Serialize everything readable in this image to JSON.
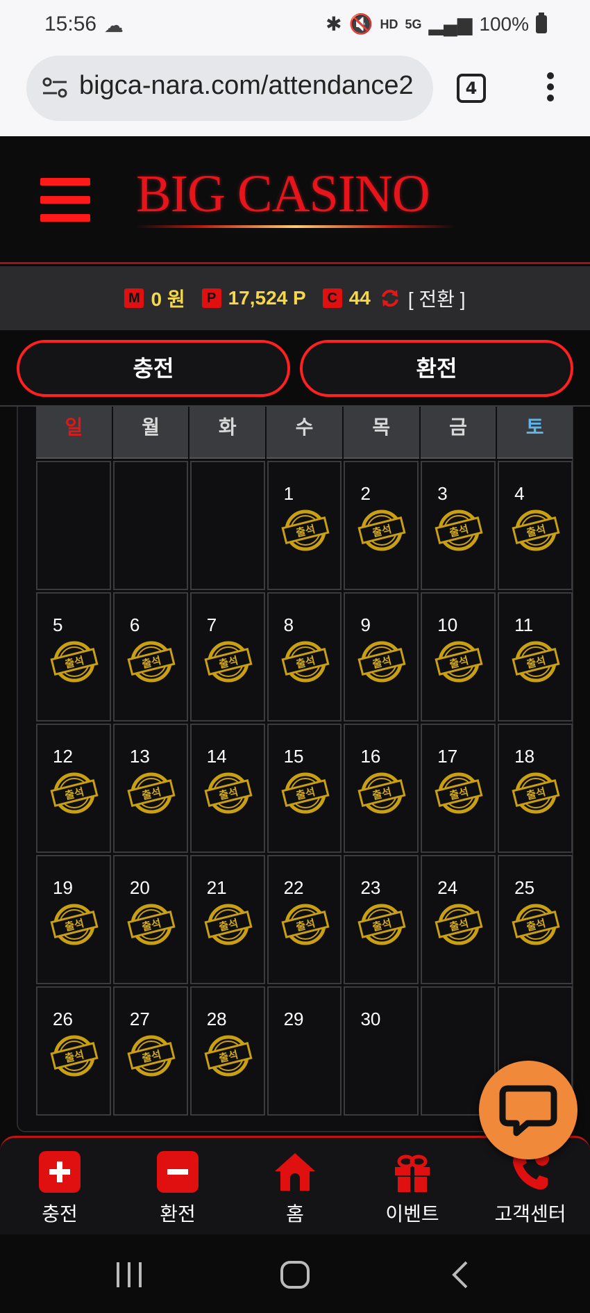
{
  "status_bar": {
    "time": "15:56",
    "battery": "100%",
    "network": "5G",
    "hd_label": "HD"
  },
  "browser": {
    "url": "bigca-nara.com/attendance2",
    "tab_count": "4"
  },
  "header": {
    "logo": "BIG CASINO"
  },
  "balance": {
    "money_badge": "M",
    "money_value": "0 원",
    "point_badge": "P",
    "point_value": "17,524 P",
    "coupon_badge": "C",
    "coupon_value": "44",
    "swap_label": "[ 전환 ]"
  },
  "actions": {
    "deposit": "충전",
    "withdraw": "환전"
  },
  "calendar": {
    "weekdays": [
      "일",
      "월",
      "화",
      "수",
      "목",
      "금",
      "토"
    ],
    "stamp_text": "출석",
    "weeks": [
      [
        {
          "d": ""
        },
        {
          "d": ""
        },
        {
          "d": ""
        },
        {
          "d": "1",
          "s": true
        },
        {
          "d": "2",
          "s": true
        },
        {
          "d": "3",
          "s": true
        },
        {
          "d": "4",
          "s": true
        }
      ],
      [
        {
          "d": "5",
          "s": true
        },
        {
          "d": "6",
          "s": true
        },
        {
          "d": "7",
          "s": true
        },
        {
          "d": "8",
          "s": true
        },
        {
          "d": "9",
          "s": true
        },
        {
          "d": "10",
          "s": true
        },
        {
          "d": "11",
          "s": true
        }
      ],
      [
        {
          "d": "12",
          "s": true
        },
        {
          "d": "13",
          "s": true
        },
        {
          "d": "14",
          "s": true
        },
        {
          "d": "15",
          "s": true
        },
        {
          "d": "16",
          "s": true
        },
        {
          "d": "17",
          "s": true
        },
        {
          "d": "18",
          "s": true
        }
      ],
      [
        {
          "d": "19",
          "s": true
        },
        {
          "d": "20",
          "s": true
        },
        {
          "d": "21",
          "s": true
        },
        {
          "d": "22",
          "s": true
        },
        {
          "d": "23",
          "s": true
        },
        {
          "d": "24",
          "s": true
        },
        {
          "d": "25",
          "s": true
        }
      ],
      [
        {
          "d": "26",
          "s": true
        },
        {
          "d": "27",
          "s": true
        },
        {
          "d": "28",
          "s": true
        },
        {
          "d": "29"
        },
        {
          "d": "30"
        },
        {
          "d": ""
        },
        {
          "d": ""
        }
      ]
    ]
  },
  "bottom_nav": {
    "items": [
      {
        "label": "충전",
        "icon": "plus-icon"
      },
      {
        "label": "환전",
        "icon": "minus-icon"
      },
      {
        "label": "홈",
        "icon": "home-icon"
      },
      {
        "label": "이벤트",
        "icon": "gift-icon"
      },
      {
        "label": "고객센터",
        "icon": "phone-24-icon"
      }
    ]
  },
  "colors": {
    "brand_red": "#e8141b",
    "gold": "#f5d84a",
    "chat_orange": "#f08a3a",
    "saturday_blue": "#5fb4e8"
  }
}
